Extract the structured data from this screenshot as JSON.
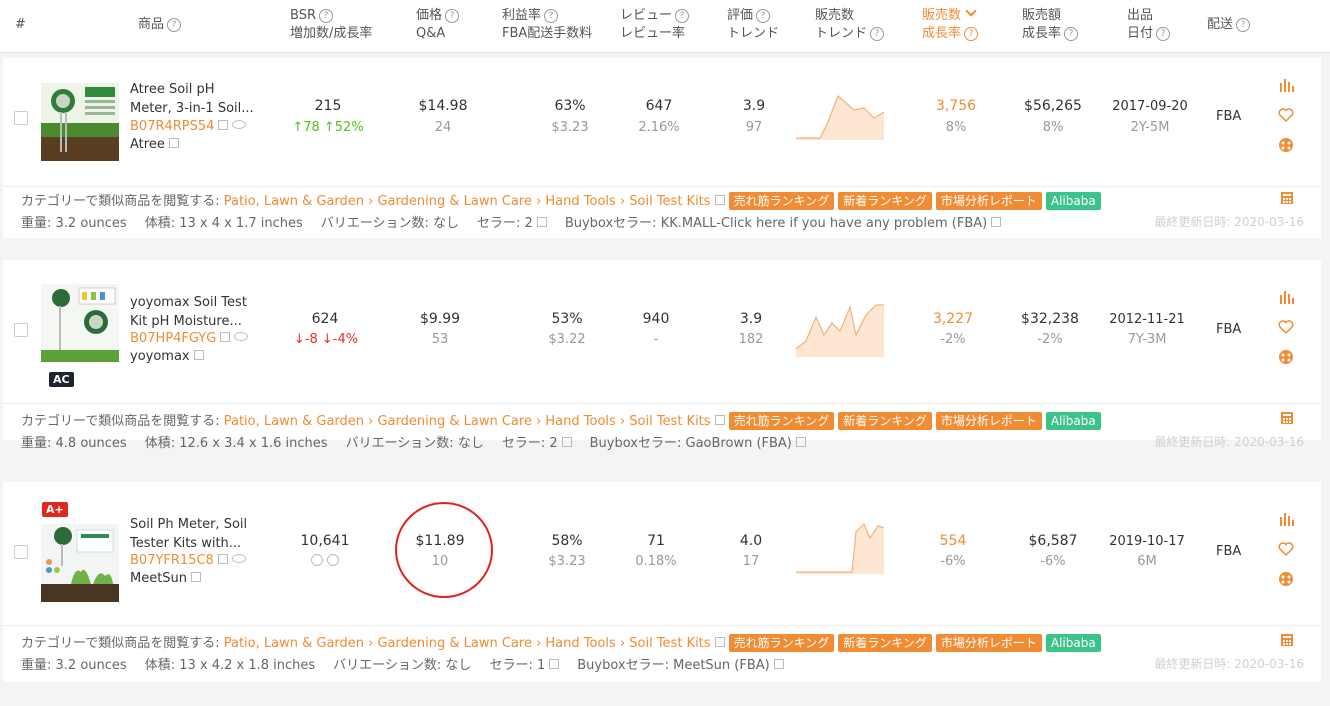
{
  "header": {
    "col_num": "#",
    "col_product": "商品",
    "col_bsr_1": "BSR",
    "col_bsr_2": "増加数/成長率",
    "col_price_1": "価格",
    "col_price_2": "Q&A",
    "col_profit_1": "利益率",
    "col_profit_2": "FBA配送手数料",
    "col_review_1": "レビュー",
    "col_review_2": "レビュー率",
    "col_rating_1": "評価",
    "col_rating_2": "トレンド",
    "col_sales_1": "販売数",
    "col_sales_2": "トレンド",
    "col_growth_1": "販売数",
    "col_growth_2": "成長率",
    "col_revenue_1": "販売額",
    "col_revenue_2": "成長率",
    "col_date_1": "出品",
    "col_date_2": "日付",
    "col_ship": "配送"
  },
  "common": {
    "category_prefix": "カテゴリーで類似商品を閲覧する: ",
    "category_path": "Patio, Lawn & Garden › Gardening & Lawn Care › Hand Tools › Soil Test Kits",
    "tag_bestseller": "売れ筋ランキング",
    "tag_new": "新着ランキング",
    "tag_report": "市場分析レポート",
    "tag_alibaba": "Alibaba",
    "weight_label": "重量: ",
    "size_label": "体積: ",
    "variation_label": "バリエーション数: ",
    "seller_label": "セラー: ",
    "buybox_label": "Buyboxセラー: ",
    "updated_label": "最終更新日時: "
  },
  "products": [
    {
      "title_line1": "Atree Soil pH",
      "title_line2": "Meter, 3-in-1 Soil...",
      "asin": "B07R4RPS54",
      "brand": "Atree",
      "bsr": "215",
      "bsr_change": "↑78",
      "bsr_rate": "↑52%",
      "price": "$14.98",
      "qa": "24",
      "profit": "63%",
      "fba_fee": "$3.23",
      "reviews": "647",
      "review_rate": "2.16%",
      "rating": "3.9",
      "rating_trend": "97",
      "sales": "3,756",
      "sales_growth": "8%",
      "revenue": "$56,265",
      "revenue_growth": "8%",
      "date": "2017-09-20",
      "age": "2Y-5M",
      "ship": "FBA",
      "weight": "3.2 ounces",
      "size": "13 x 4 x 1.7 inches",
      "variations": "なし",
      "sellers": "2",
      "buybox": "KK.MALL-Click here if you have any problem  (FBA)",
      "updated": "2020-03-16"
    },
    {
      "title_line1": "yoyomax Soil Test",
      "title_line2": "Kit pH Moisture...",
      "asin": "B07HP4FGYG",
      "brand": "yoyomax",
      "badge": "AC",
      "bsr": "624",
      "bsr_change": "↓-8",
      "bsr_rate": "↓-4%",
      "price": "$9.99",
      "qa": "53",
      "profit": "53%",
      "fba_fee": "$3.22",
      "reviews": "940",
      "review_rate": "-",
      "rating": "3.9",
      "rating_trend": "182",
      "sales": "3,227",
      "sales_growth": "-2%",
      "revenue": "$32,238",
      "revenue_growth": "-2%",
      "date": "2012-11-21",
      "age": "7Y-3M",
      "ship": "FBA",
      "weight": "4.8 ounces",
      "size": "12.6 x 3.4 x 1.6 inches",
      "variations": "なし",
      "sellers": "2",
      "buybox": "GaoBrown  (FBA)",
      "updated": "2020-03-16"
    },
    {
      "title_line1": "Soil Ph Meter, Soil",
      "title_line2": "Tester Kits with...",
      "asin": "B07YFR15C8",
      "brand": "MeetSun",
      "badge": "A+",
      "bsr": "10,641",
      "price": "$11.89",
      "qa": "10",
      "profit": "58%",
      "fba_fee": "$3.23",
      "reviews": "71",
      "review_rate": "0.18%",
      "rating": "4.0",
      "rating_trend": "17",
      "sales": "554",
      "sales_growth": "-6%",
      "revenue": "$6,587",
      "revenue_growth": "-6%",
      "date": "2019-10-17",
      "age": "6M",
      "ship": "FBA",
      "weight": "3.2 ounces",
      "size": "13 x 4.2 x 1.8 inches",
      "variations": "なし",
      "sellers": "1",
      "buybox": "MeetSun  (FBA)",
      "updated": "2020-03-16"
    }
  ],
  "colors": {
    "accent": "#f08c34",
    "up": "#52c41a",
    "down": "#e8312c",
    "alibaba": "#3cc38a",
    "highlight_circle": "#e0241c"
  }
}
